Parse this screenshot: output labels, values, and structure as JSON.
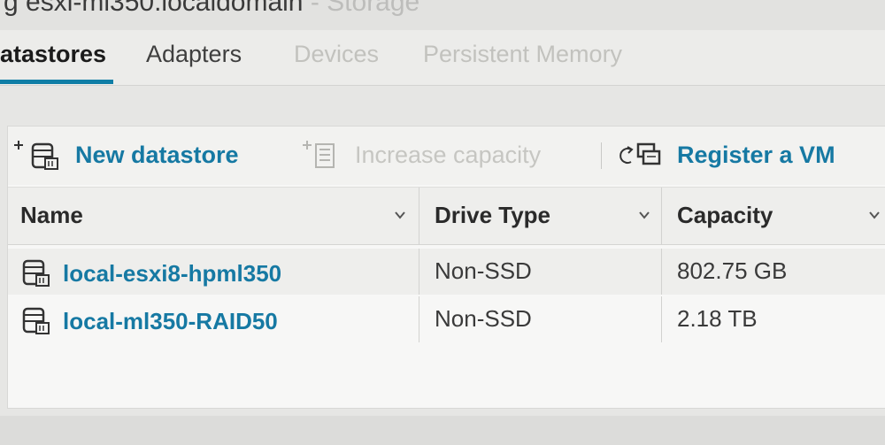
{
  "window": {
    "title_main": "g esxi-ml350.localdomain",
    "title_suffix": " - Storage"
  },
  "tabs": [
    {
      "label": "atastores",
      "state": "active"
    },
    {
      "label": "Adapters",
      "state": "normal"
    },
    {
      "label": "Devices",
      "state": "disabled"
    },
    {
      "label": "Persistent Memory",
      "state": "disabled"
    }
  ],
  "toolbar": {
    "new_datastore": "New datastore",
    "increase_capacity": "Increase capacity",
    "register_vm": "Register a VM",
    "icons": {
      "new_datastore": "datastore-add-icon",
      "increase_capacity": "capacity-add-icon",
      "register_vm": "register-vm-icon"
    }
  },
  "table": {
    "columns": [
      "Name",
      "Drive Type",
      "Capacity"
    ],
    "rows": [
      {
        "name": "local-esxi8-hpml350",
        "drive_type": "Non-SSD",
        "capacity": "802.75 GB"
      },
      {
        "name": "local-ml350-RAID50",
        "drive_type": "Non-SSD",
        "capacity": "2.18 TB"
      }
    ]
  },
  "colors": {
    "accent": "#1679a3",
    "tab_active_underline": "#0f7ea6",
    "disabled_text": "#c6c6c2"
  }
}
